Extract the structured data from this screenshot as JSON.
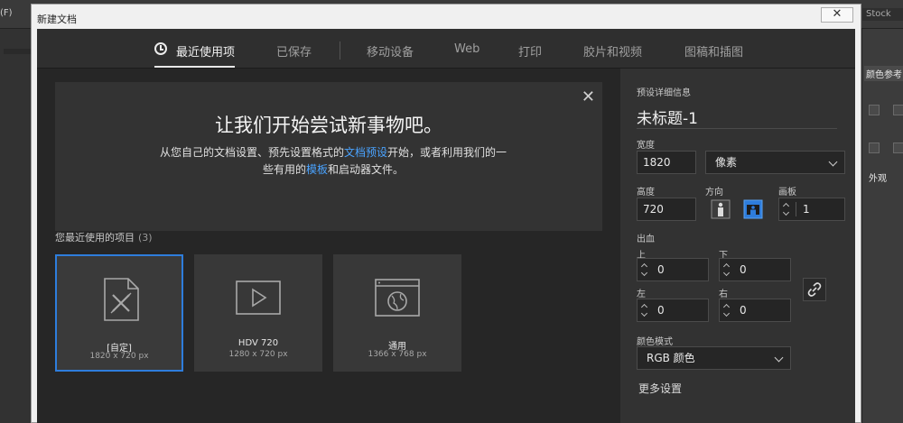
{
  "background_app": {
    "menu_fragment": "(F)",
    "stock_fragment": "Stock",
    "panel_tab": "颜色参考",
    "panel_tab2": "外观"
  },
  "dialog": {
    "title": "新建文档",
    "close_symbol": "✕"
  },
  "tabs": [
    {
      "label": "最近使用项",
      "active": true
    },
    {
      "label": "已保存"
    },
    {
      "label": "移动设备"
    },
    {
      "label": "Web"
    },
    {
      "label": "打印"
    },
    {
      "label": "胶片和视频"
    },
    {
      "label": "图稿和插图"
    }
  ],
  "welcome": {
    "title": "让我们开始尝试新事物吧。",
    "line1_pre": "从您自己的文档设置、预先设置格式的",
    "line1_link": "文档预设",
    "line1_post": "开始，或者利用我们的一",
    "line2_pre": "些有用的",
    "line2_link": "模板",
    "line2_post": "和启动器文件。",
    "close_symbol": "✕"
  },
  "recent": {
    "label": "您最近使用的项目",
    "count": "(3)",
    "items": [
      {
        "name": "[自定]",
        "size": "1820 x 720 px",
        "icon": "custom-document-icon",
        "selected": true
      },
      {
        "name": "HDV 720",
        "size": "1280 x 720 px",
        "icon": "video-play-icon"
      },
      {
        "name": "通用",
        "size": "1366 x 768 px",
        "icon": "web-globe-icon"
      }
    ]
  },
  "preset_details": {
    "section_label": "预设详细信息",
    "doc_name": "未标题-1",
    "width_label": "宽度",
    "width_value": "1820",
    "unit_value": "像素",
    "height_label": "高度",
    "height_value": "720",
    "orientation_label": "方向",
    "artboards_label": "画板",
    "artboards_value": "1",
    "bleed_label": "出血",
    "bleed_top_label": "上",
    "bleed_top": "0",
    "bleed_bottom_label": "下",
    "bleed_bottom": "0",
    "bleed_left_label": "左",
    "bleed_left": "0",
    "bleed_right_label": "右",
    "bleed_right": "0",
    "color_mode_label": "颜色模式",
    "color_mode_value": "RGB 颜色",
    "more_settings": "更多设置"
  },
  "colors": {
    "accent": "#2e7ddc",
    "link": "#4aa3ff"
  }
}
